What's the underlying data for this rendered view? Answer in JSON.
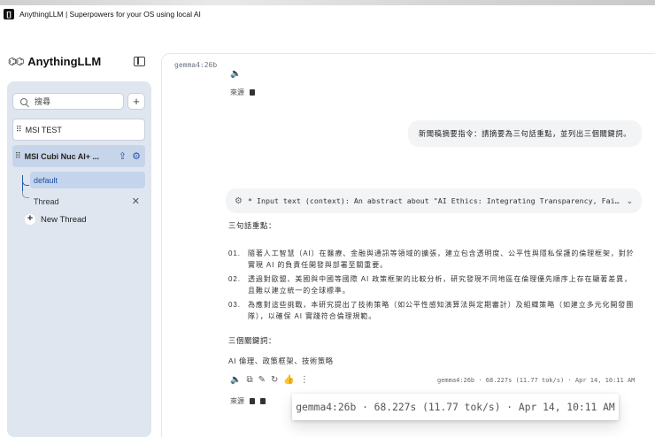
{
  "window": {
    "title": "AnythingLLM | Superpowers for your OS using local AI",
    "app_icon_glyph": "[]"
  },
  "sidebar": {
    "logo_mark": "⌬⌬",
    "logo_text": "AnythingLLM",
    "search_placeholder": "搜尋",
    "workspaces": [
      {
        "label": "MSI TEST"
      },
      {
        "label": "MSI Cubi Nuc AI+ ..."
      }
    ],
    "threads": [
      {
        "label": "default"
      },
      {
        "label": "Thread"
      }
    ],
    "new_thread_label": "New Thread"
  },
  "chat": {
    "model_tag": "gemma4:26b",
    "sources_label": "來源",
    "user_message": "新聞稿摘要指令：請摘要為三句話重點，並列出三個關鍵詞。",
    "context_text": "* Input text (context): An abstract about \"AI Ethics: Integrating Transparency, Fai…",
    "heading_summary": "三句話重點：",
    "points": [
      {
        "num": "01.",
        "text": "隨著人工智慧（AI）在醫療、金融與通訊等領域的擴張，建立包含透明度、公平性與隱私保護的倫理框架，對於實現 AI 的負責任開發與部署至關重要。"
      },
      {
        "num": "02.",
        "text": "透過對歐盟、美國與中國等國際 AI 政策框架的比較分析，研究發現不同地區在倫理優先順序上存在顯著差異，且難以建立統一的全球標準。"
      },
      {
        "num": "03.",
        "text": "為應對這些挑戰，本研究提出了技術策略（如公平性感知演算法與定期審計）及組織策略（如建立多元化開發團隊），以確保 AI 實踐符合倫理規範。"
      }
    ],
    "heading_keywords": "三個關鍵詞：",
    "keywords": "AI 倫理、政策框架、技術策略",
    "meta": "gemma4:26b · 68.227s (11.77 tok/s) · Apr 14, 10:11 AM",
    "tooltip": "gemma4:26b · 68.227s (11.77 tok/s) · Apr 14, 10:11 AM"
  }
}
